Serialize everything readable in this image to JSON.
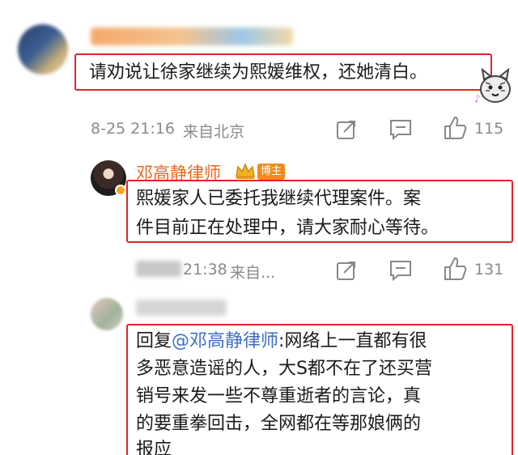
{
  "comment1": {
    "text": "请劝说让徐家继续为熙媛维权，还她清白。",
    "date": "8-25 21:16",
    "location": "来自北京",
    "likes": "115"
  },
  "reply1": {
    "author": "邓高静律师",
    "badge": "博主",
    "line1": "熙媛家人已委托我继续代理案件。案",
    "line2": "件目前正在处理中，请大家耐心等待。",
    "time": "21:38",
    "location": "来自...",
    "likes": "131"
  },
  "reply2": {
    "reply_prefix": "回复",
    "mention": "@邓高静律师",
    "line1_rest": ":网络上一直都有很",
    "line2": "多恶意造谣的人，大S都不在了还买营",
    "line3": "销号来发一些不尊重逝者的言论，真",
    "line4": "的要重拳回击，全网都在等那娘俩的",
    "line5": "报应"
  },
  "colors": {
    "highlight_box": "#e0242a",
    "author_name": "#ea6a1f",
    "mention": "#3b6ec1",
    "meta_gray": "#8a8a8a"
  },
  "icons": [
    "share-icon",
    "comment-icon",
    "like-icon",
    "crown-icon",
    "sticker-icon"
  ]
}
